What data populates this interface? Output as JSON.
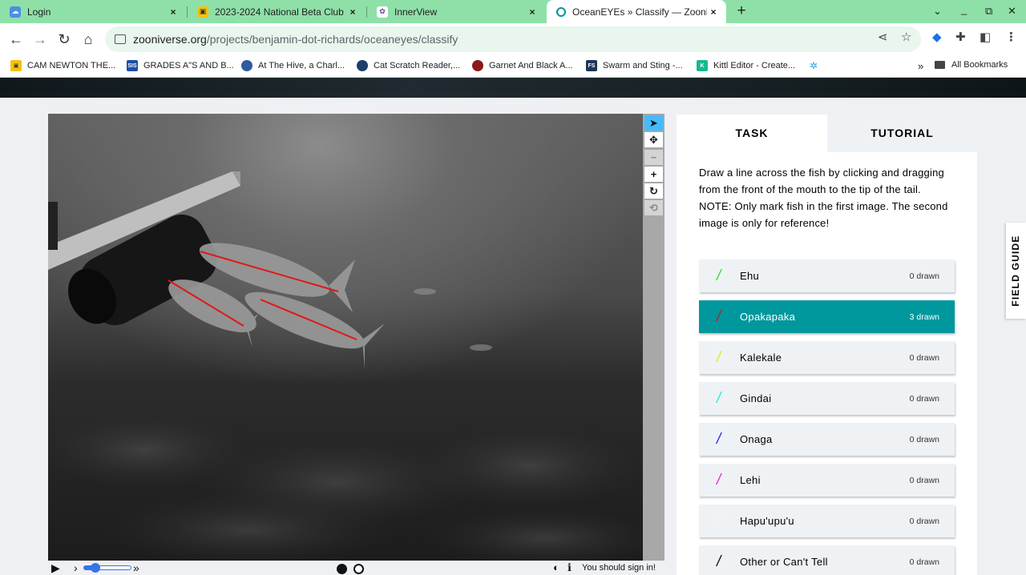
{
  "browser": {
    "tabs": [
      {
        "title": "Login",
        "icon": "cloud-icon",
        "color": "#4a8fe7"
      },
      {
        "title": "2023-2024 National Beta Club (",
        "icon": "classroom-icon",
        "color": "#f4c20d"
      },
      {
        "title": "InnerView",
        "icon": "paw-icon",
        "color": "#6b3fa0"
      },
      {
        "title": "OceanEYEs » Classify — Zooniverse",
        "icon": "zooniverse-icon",
        "color": "#00979d",
        "active": true
      }
    ],
    "close_glyph": "×",
    "new_tab_glyph": "+",
    "url_domain": "zooniverse.org",
    "url_path": "/projects/benjamin-dot-richards/oceaneyes/classify",
    "bookmarks": [
      {
        "label": "CAM NEWTON THE...",
        "icon": "classroom-icon",
        "color": "#f4c20d",
        "abbr": ""
      },
      {
        "label": "GRADES A\"S AND B...",
        "icon": "sis-icon",
        "color": "#1b4fa8",
        "abbr": "SIS"
      },
      {
        "label": "At The Hive, a Charl...",
        "icon": "hive-icon",
        "color": "#2d5aa0",
        "abbr": ""
      },
      {
        "label": "Cat Scratch Reader,...",
        "icon": "cat-scratch-icon",
        "color": "#1a3d6b",
        "abbr": ""
      },
      {
        "label": "Garnet And Black A...",
        "icon": "garnet-icon",
        "color": "#8b1a1a",
        "abbr": ""
      },
      {
        "label": "Swarm and Sting -...",
        "icon": "swarm-icon",
        "color": "#1d3557",
        "abbr": "FS"
      },
      {
        "label": "Kittl Editor - Create...",
        "icon": "kittl-icon",
        "color": "#17b890",
        "abbr": "K"
      }
    ],
    "all_bookmarks": "All Bookmarks",
    "overflow_glyph": "»"
  },
  "subject": {
    "drawn_lines": [
      {
        "species": "Opakapaka",
        "color": "#e01818"
      },
      {
        "species": "Opakapaka",
        "color": "#e01818"
      },
      {
        "species": "Opakapaka",
        "color": "#e01818"
      }
    ]
  },
  "drawing_tools": [
    "pointer-icon",
    "move-icon",
    "zoom-out-icon",
    "zoom-in-icon",
    "rotate-icon",
    "reset-icon"
  ],
  "player": {
    "play_glyph": "▶",
    "step_glyph": "›",
    "fast_glyph": "»",
    "signin_text": "You should sign in!"
  },
  "task": {
    "tab_task": "TASK",
    "tab_tutorial": "TUTORIAL",
    "instructions": "Draw a line across the fish by clicking and dragging from the front of the mouth to the tip of the tail.",
    "note": "NOTE: Only mark fish in the first image. The second image is only for reference!",
    "tools": [
      {
        "label": "Ehu",
        "count": "0 drawn",
        "color": "#33dd33"
      },
      {
        "label": "Opakapaka",
        "count": "3 drawn",
        "color": "#c2182b",
        "active": true
      },
      {
        "label": "Kalekale",
        "count": "0 drawn",
        "color": "#e6e62a"
      },
      {
        "label": "Gindai",
        "count": "0 drawn",
        "color": "#29e6e6"
      },
      {
        "label": "Onaga",
        "count": "0 drawn",
        "color": "#2a2ae6"
      },
      {
        "label": "Lehi",
        "count": "0 drawn",
        "color": "#e62ae6"
      },
      {
        "label": "Hapu'upu'u",
        "count": "0 drawn",
        "color": "#f5f5f5"
      },
      {
        "label": "Other or Can't Tell",
        "count": "0 drawn",
        "color": "#111111"
      }
    ]
  },
  "field_guide": "FIELD GUIDE"
}
